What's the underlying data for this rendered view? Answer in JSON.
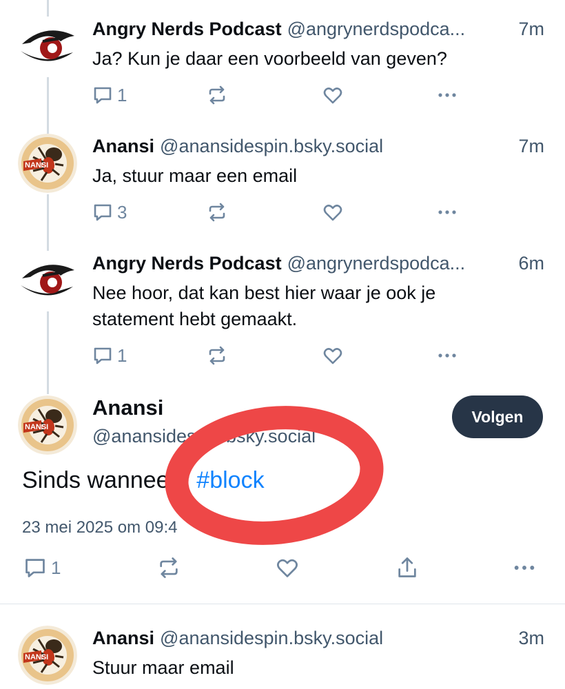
{
  "posts": [
    {
      "author": "Angry Nerds Podcast",
      "handle": "@angrynerdspodca...",
      "time": "7m",
      "text": "Ja? Kun je daar een voorbeeld van geven?",
      "replies": "1",
      "avatar": "angry-nerds-eye-logo"
    },
    {
      "author": "Anansi",
      "handle": "@anansidespin.bsky.social",
      "time": "7m",
      "text": "Ja, stuur maar een email",
      "replies": "3",
      "avatar": "anansi-spider-logo"
    },
    {
      "author": "Angry Nerds Podcast",
      "handle": "@angrynerdspodca...",
      "time": "6m",
      "text_line1": "Nee hoor, dat kan best hier waar je ook je",
      "text_line2": "statement hebt gemaakt.",
      "replies": "1",
      "avatar": "angry-nerds-eye-logo"
    }
  ],
  "main_post": {
    "author": "Anansi",
    "handle": "@anansidespin.bsky.social",
    "follow_label": "Volgen",
    "text_prefix": "Sinds wanneer?",
    "hashtag": "#block",
    "date": "23 mei 2025 om 09:4",
    "replies": "1"
  },
  "last_post": {
    "author": "Anansi",
    "handle": "@anansidespin.bsky.social",
    "time": "3m",
    "text": "Stuur maar email"
  },
  "icons": {
    "reply": "speech-bubble-icon",
    "repost": "repost-arrows-icon",
    "like": "heart-icon",
    "more": "ellipsis-icon",
    "share": "share-icon"
  },
  "colors": {
    "accent": "#1083fe",
    "button": "#273547",
    "muted": "#42576c",
    "annotation": "#ee4747"
  }
}
